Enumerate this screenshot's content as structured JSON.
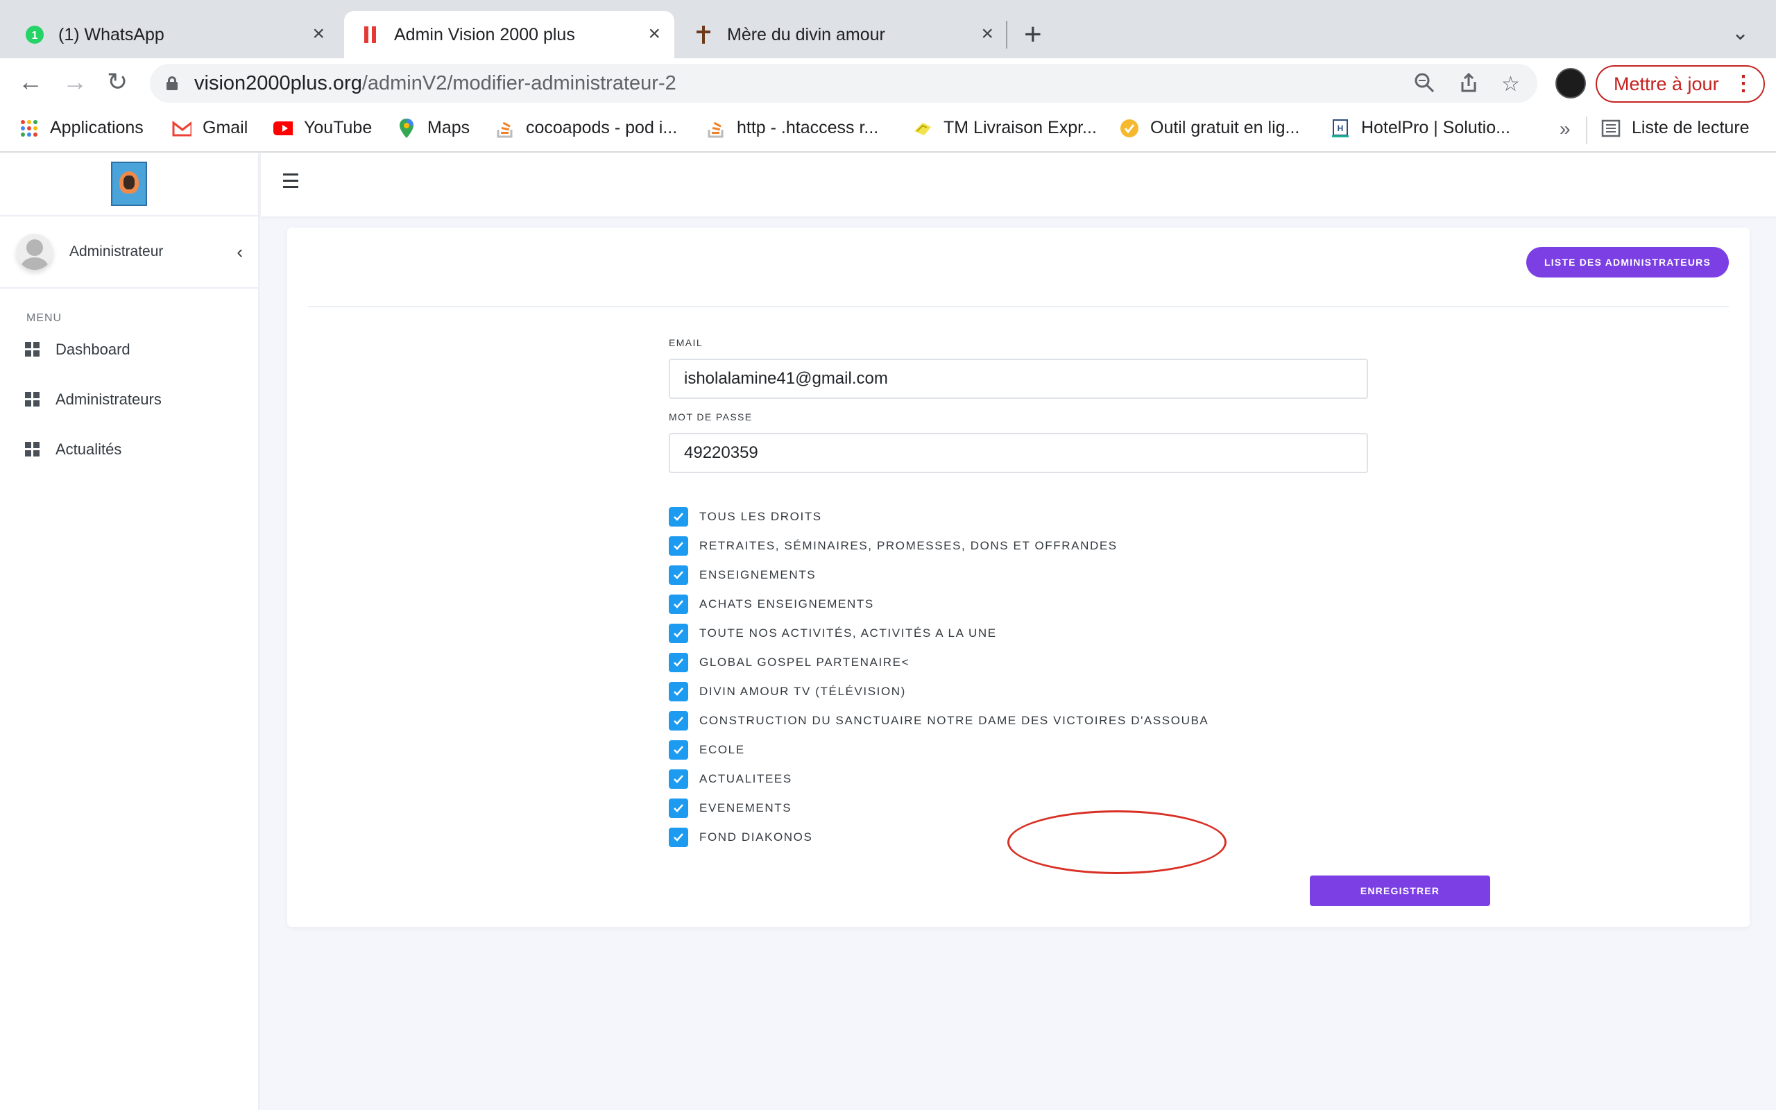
{
  "browser": {
    "tabs": [
      {
        "title": "(1) WhatsApp",
        "icon": "whatsapp-icon",
        "active": false
      },
      {
        "title": "Admin Vision 2000 plus",
        "icon": "vision-icon",
        "active": true
      },
      {
        "title": "Mère du divin amour",
        "icon": "cross-icon",
        "active": false
      }
    ],
    "url_host": "vision2000plus.org",
    "url_path": "/adminV2/modifier-administrateur-2",
    "update_label": "Mettre à jour",
    "bookmarks": [
      {
        "label": "Applications",
        "icon": "apps-grid-icon"
      },
      {
        "label": "Gmail",
        "icon": "gmail-icon"
      },
      {
        "label": "YouTube",
        "icon": "youtube-icon"
      },
      {
        "label": "Maps",
        "icon": "maps-pin-icon"
      },
      {
        "label": "cocoapods - pod i...",
        "icon": "stackoverflow-icon"
      },
      {
        "label": "http - .htaccess r...",
        "icon": "stackoverflow-icon"
      },
      {
        "label": "TM Livraison Expr...",
        "icon": "delivery-icon"
      },
      {
        "label": "Outil gratuit en lig...",
        "icon": "check-badge-icon"
      },
      {
        "label": "HotelPro | Solutio...",
        "icon": "hotelpro-icon"
      }
    ],
    "more_bookmarks": "»",
    "reading_list": "Liste de lecture"
  },
  "sidebar": {
    "user_name": "Administrateur",
    "menu_title": "MENU",
    "items": [
      {
        "label": "Dashboard"
      },
      {
        "label": "Administrateurs"
      },
      {
        "label": "Actualités"
      }
    ]
  },
  "main": {
    "list_button": "LISTE DES ADMINISTRATEURS",
    "email_label": "EMAIL",
    "email_value": "isholalamine41@gmail.com",
    "password_label": "MOT DE PASSE",
    "password_value": "49220359",
    "permissions": [
      {
        "label": "TOUS LES DROITS",
        "checked": true
      },
      {
        "label": "RETRAITES, SÉMINAIRES, PROMESSES, DONS ET OFFRANDES",
        "checked": true
      },
      {
        "label": "ENSEIGNEMENTS",
        "checked": true
      },
      {
        "label": "ACHATS ENSEIGNEMENTS",
        "checked": true
      },
      {
        "label": "TOUTE NOS ACTIVITÉS, ACTIVITÉS A LA UNE",
        "checked": true
      },
      {
        "label": "GLOBAL GOSPEL PARTENAIRE<",
        "checked": true
      },
      {
        "label": "DIVIN AMOUR TV (TÉLÉVISION)",
        "checked": true
      },
      {
        "label": "CONSTRUCTION DU SANCTUAIRE NOTRE DAME DES VICTOIRES D'ASSOUBA",
        "checked": true
      },
      {
        "label": "ECOLE",
        "checked": true
      },
      {
        "label": "ACTUALITEES",
        "checked": true
      },
      {
        "label": "EVENEMENTS",
        "checked": true
      },
      {
        "label": "FOND DIAKONOS",
        "checked": true
      }
    ],
    "save_button": "ENREGISTRER"
  },
  "colors": {
    "accent": "#7b3fe4",
    "checkbox": "#1d9bf0",
    "annotation": "#d93025"
  }
}
